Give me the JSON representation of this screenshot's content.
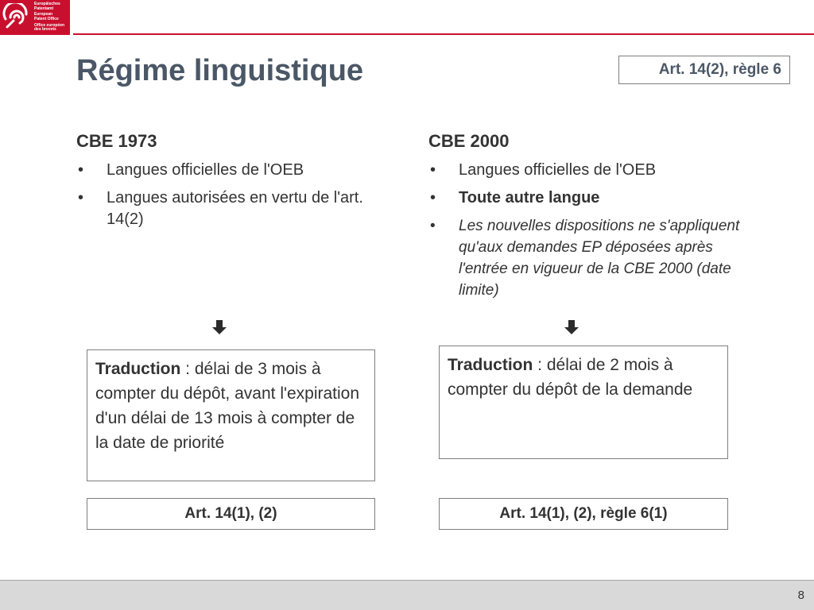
{
  "logo": {
    "lines": [
      "Europäisches",
      "Patentamt",
      "European",
      "Patent Office",
      "Office européen",
      "des brevets"
    ],
    "colors": {
      "background": "#c8102e",
      "mark": "#ffffff"
    },
    "icon": "epo-spiral-logo-icon"
  },
  "header": {
    "title": "Régime linguistique",
    "reference": "Art. 14(2), règle 6",
    "accent_color": "#c8102e"
  },
  "left": {
    "heading": "CBE 1973",
    "bullets": [
      "Langues officielles de l'OEB",
      "Langues autorisées en vertu de l'art. 14(2)"
    ],
    "arrow_icon": "down-arrow-icon",
    "translation": {
      "label": "Traduction",
      "text": " : délai de 3 mois à compter du dépôt, avant l'expiration d'un délai de 13 mois à compter de la date de priorité"
    },
    "article": "Art. 14(1), (2)"
  },
  "right": {
    "heading": "CBE 2000",
    "bullets": [
      "Langues officielles de l'OEB",
      "Toute autre langue",
      "Les nouvelles dispositions ne s'appliquent qu'aux demandes EP déposées après l'entrée en vigueur de la CBE 2000 (date limite)"
    ],
    "arrow_icon": "down-arrow-icon",
    "translation": {
      "label": "Traduction",
      "text": " : délai de 2 mois à compter du dépôt de la demande"
    },
    "article": "Art. 14(1), (2), règle 6(1)"
  },
  "bullet_glyph": "•",
  "footer": {
    "page_number": "8"
  }
}
